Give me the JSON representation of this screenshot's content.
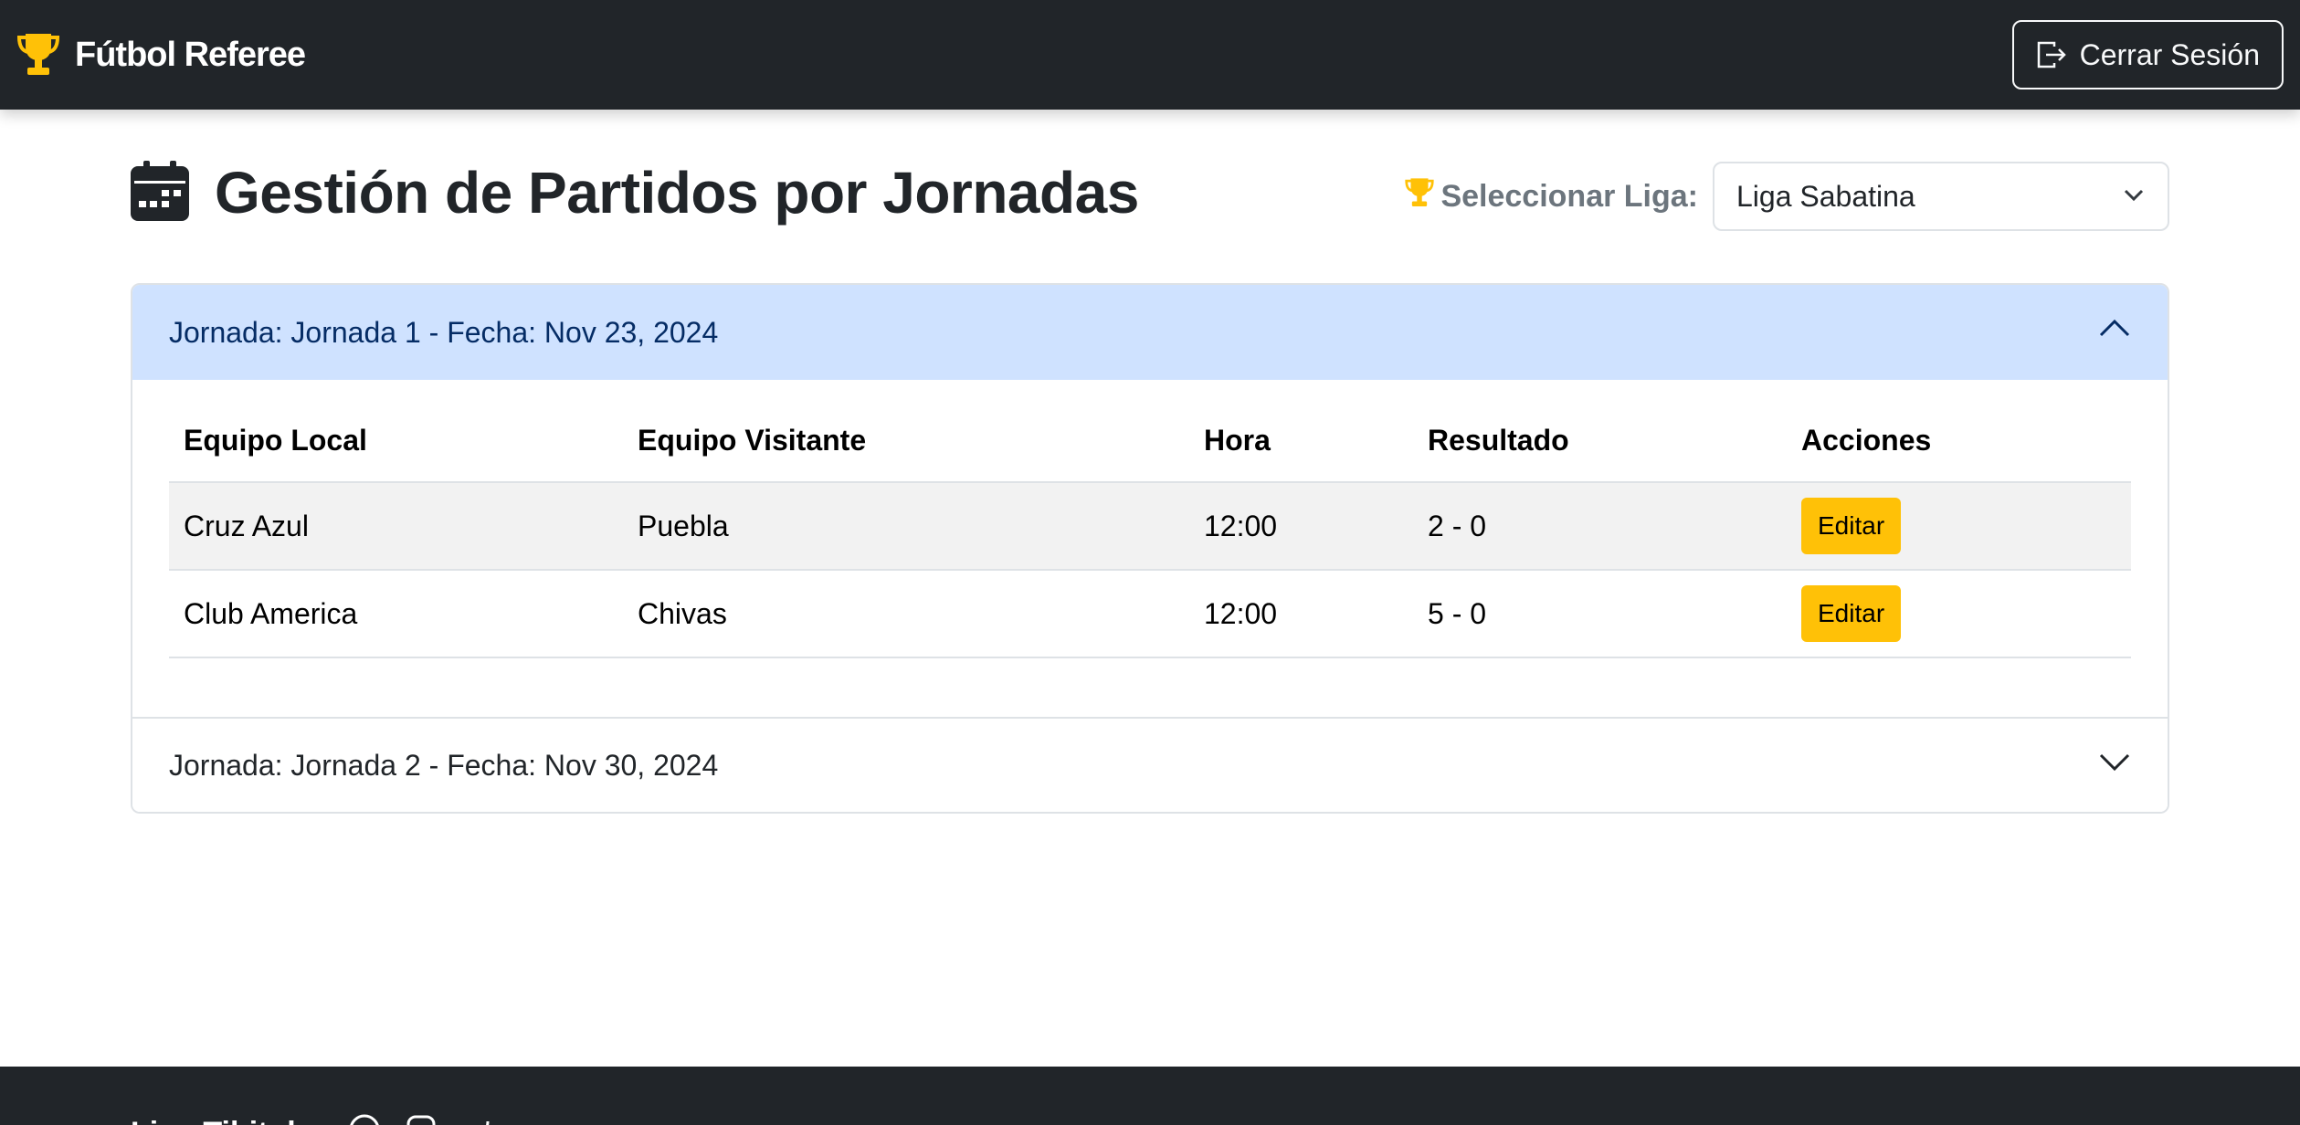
{
  "navbar": {
    "brand": "Fútbol Referee",
    "logout_label": "Cerrar Sesión"
  },
  "page": {
    "title": "Gestión de Partidos por Jornadas",
    "league_label": "Seleccionar Liga:",
    "league_selected": "Liga Sabatina"
  },
  "jornadas": [
    {
      "header": "Jornada: Jornada 1 - Fecha: Nov 23, 2024",
      "expanded": true,
      "columns": [
        "Equipo Local",
        "Equipo Visitante",
        "Hora",
        "Resultado",
        "Acciones"
      ],
      "rows": [
        {
          "local": "Cruz Azul",
          "visitante": "Puebla",
          "hora": "12:00",
          "resultado": "2 - 0",
          "accion": "Editar"
        },
        {
          "local": "Club America",
          "visitante": "Chivas",
          "hora": "12:00",
          "resultado": "5 - 0",
          "accion": "Editar"
        }
      ]
    },
    {
      "header": "Jornada: Jornada 2 - Fecha: Nov 30, 2024",
      "expanded": false
    }
  ],
  "footer": {
    "brand": "Liga Tibitolm"
  },
  "colors": {
    "navbar_bg": "#212529",
    "accent_gold": "#ffc107",
    "accordion_active_bg": "#cfe2ff"
  },
  "icons": [
    "trophy-icon",
    "logout-icon",
    "calendar-icon",
    "chevron-down-icon",
    "chevron-up-icon",
    "facebook-icon",
    "instagram-icon",
    "twitter-icon"
  ]
}
